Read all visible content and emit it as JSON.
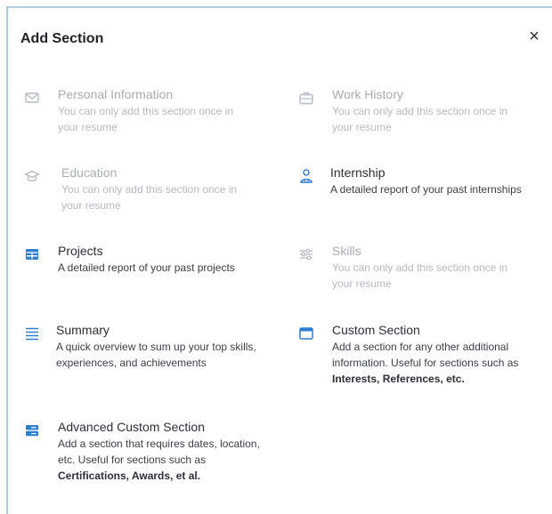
{
  "dialog": {
    "title": "Add Section",
    "close_label": "×"
  },
  "sections": {
    "personal": {
      "name": "Personal Information",
      "desc": "You can only add this section once in your resume"
    },
    "work": {
      "name": "Work History",
      "desc": "You can only add this section once in your resume"
    },
    "education": {
      "name": "Education",
      "desc": "You can only add this section once in your resume"
    },
    "internship": {
      "name": "Internship",
      "desc": "A detailed report of your past internships"
    },
    "projects": {
      "name": "Projects",
      "desc": "A detailed report of your past projects"
    },
    "skills": {
      "name": "Skills",
      "desc": "You can only add this section once in your resume"
    },
    "summary": {
      "name": "Summary",
      "desc": "A quick overview to sum up your top skills, experiences, and achievements"
    },
    "custom": {
      "name": "Custom Section",
      "desc": "Add a section for any other additional information. Useful for sections such as ",
      "desc_bold": "Interests, References, etc."
    },
    "advanced": {
      "name": "Advanced Custom Section",
      "desc": "Add a section that requires dates, location, etc. Useful for sections such as ",
      "desc_bold": "Certifications, Awards, et al."
    }
  },
  "colors": {
    "accent": "#2f7fd0",
    "disabled_icon": "#b4bbc2",
    "border": "#a9cdea"
  },
  "icons": {
    "personal": "envelope-icon",
    "work": "briefcase-icon",
    "education": "graduation-cap-icon",
    "internship": "user-group-icon",
    "projects": "table-icon",
    "skills": "sliders-icon",
    "summary": "align-lines-icon",
    "custom": "window-icon",
    "advanced": "server-icon"
  }
}
